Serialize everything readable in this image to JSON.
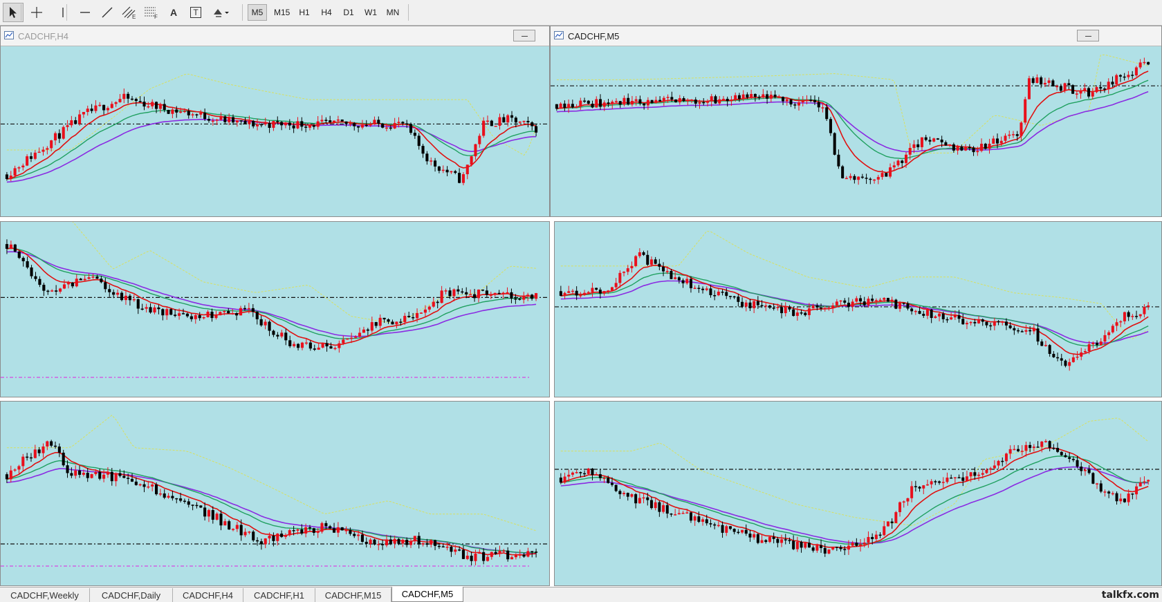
{
  "toolbar": {
    "tools": [
      {
        "name": "cursor-icon",
        "active": true
      },
      {
        "name": "crosshair-icon"
      },
      {
        "name": "vertical-line-icon"
      },
      {
        "name": "horizontal-line-icon"
      },
      {
        "name": "trendline-icon"
      },
      {
        "name": "equidistant-channel-icon",
        "sub": "E"
      },
      {
        "name": "fibonacci-icon",
        "sub": "F"
      },
      {
        "name": "text-icon",
        "label": "A"
      },
      {
        "name": "text-label-icon",
        "label": "T"
      },
      {
        "name": "shapes-dropdown-icon"
      }
    ],
    "timeframes": [
      {
        "label": "M5",
        "active": true
      },
      {
        "label": "M15"
      },
      {
        "label": "H1"
      },
      {
        "label": "H4"
      },
      {
        "label": "D1"
      },
      {
        "label": "W1"
      },
      {
        "label": "MN"
      }
    ]
  },
  "windows": [
    {
      "title": "CADCHF,H4",
      "active": false
    },
    {
      "title": "CADCHF,M5",
      "active": true
    }
  ],
  "tabs": [
    {
      "label": "CADCHF,Weekly"
    },
    {
      "label": "CADCHF,Daily"
    },
    {
      "label": "CADCHF,H4"
    },
    {
      "label": "CADCHF,H1"
    },
    {
      "label": "CADCHF,M15"
    },
    {
      "label": "CADCHF,M5",
      "active": true
    }
  ],
  "watermark": "talkfx.com",
  "colors": {
    "chart_bg": "#b0e0e6",
    "bull_candle": "#e8101c",
    "bear_candle": "#000000",
    "ma_fast": "#e01010",
    "ma_mid": "#20a060",
    "ma_slow": "#8a2be2",
    "band": "#d8e060",
    "level": "#101010",
    "level_magenta": "#e020e0"
  }
}
